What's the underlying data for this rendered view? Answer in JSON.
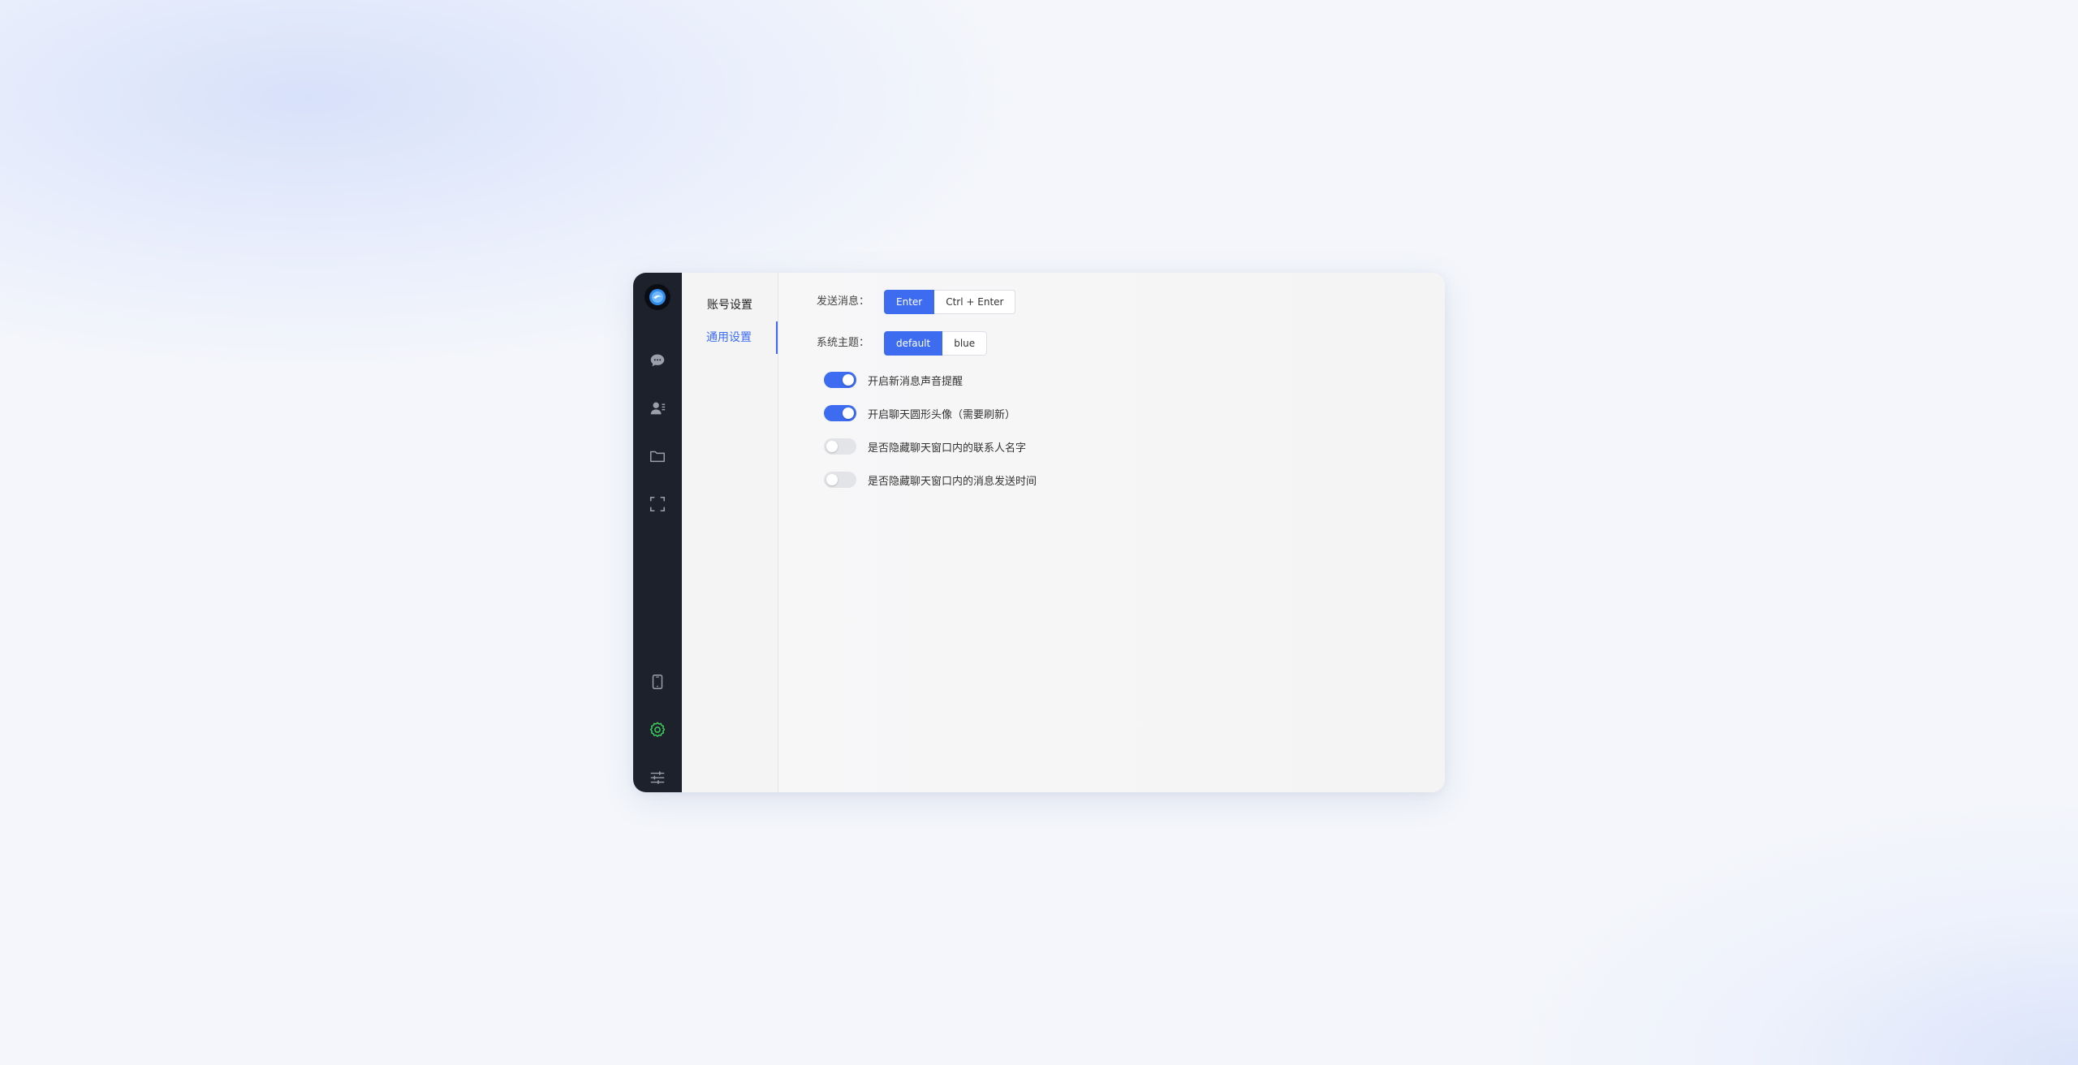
{
  "sidebar": {
    "icons": [
      "app-logo-icon",
      "chat-icon",
      "contacts-icon",
      "folder-icon",
      "scan-icon",
      "phone-icon",
      "settings-icon",
      "sliders-icon"
    ],
    "settings_active_color": "#3ccf5a"
  },
  "menu": {
    "items": [
      {
        "label": "账号设置",
        "active": false
      },
      {
        "label": "通用设置",
        "active": true
      }
    ]
  },
  "settings": {
    "send_message": {
      "label": "发送消息：",
      "options": [
        "Enter",
        "Ctrl + Enter"
      ],
      "selected": "Enter"
    },
    "theme": {
      "label": "系统主题：",
      "options": [
        "default",
        "blue"
      ],
      "selected": "default"
    },
    "toggles": [
      {
        "label": "开启新消息声音提醒",
        "on": true
      },
      {
        "label": "开启聊天圆形头像（需要刷新）",
        "on": true
      },
      {
        "label": "是否隐藏聊天窗口内的联系人名字",
        "on": false
      },
      {
        "label": "是否隐藏聊天窗口内的消息发送时间",
        "on": false
      }
    ]
  },
  "colors": {
    "accent": "#3d6cf0",
    "rail": "#1d212b"
  }
}
